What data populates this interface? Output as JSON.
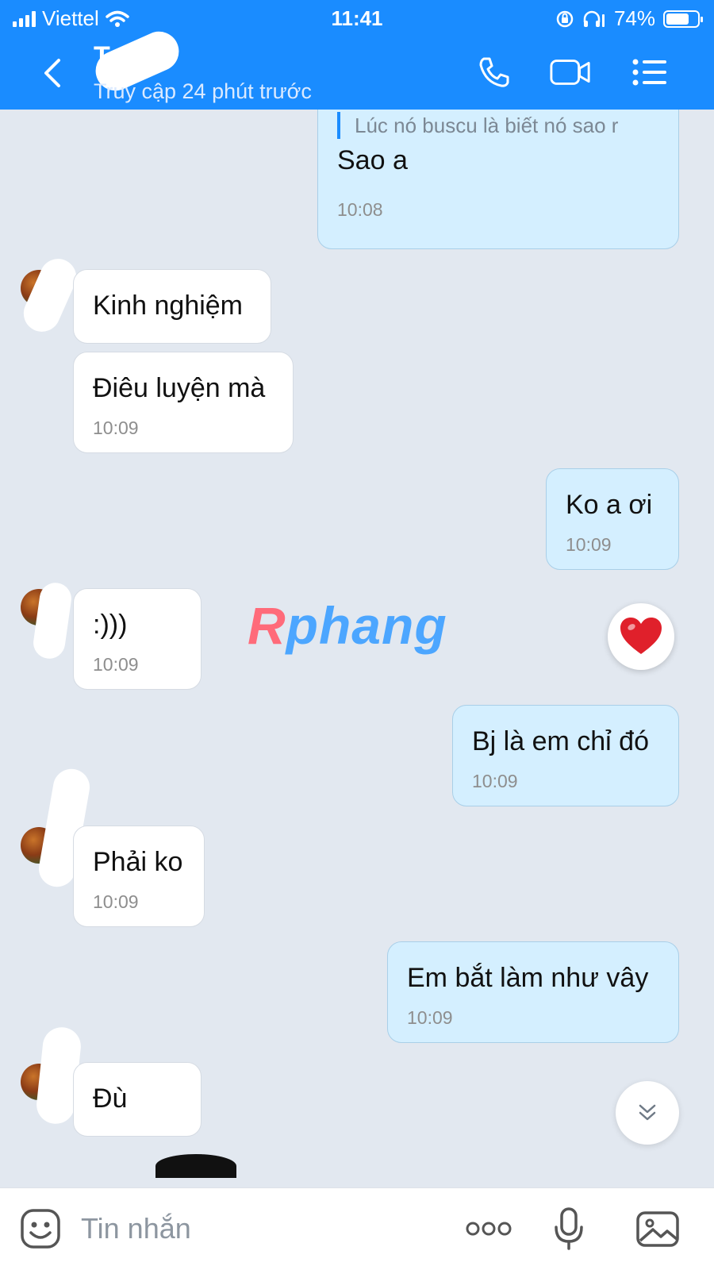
{
  "status_bar": {
    "carrier": "Viettel",
    "time": "11:41",
    "battery": "74%",
    "battery_level": 0.74
  },
  "header": {
    "contact_name": "Te",
    "last_seen": "Truy cập 24 phút trước"
  },
  "messages": [
    {
      "direction": "out",
      "quote": "Lúc nó buscu là biết nó sao r",
      "text": "Sao a",
      "time": "10:08"
    },
    {
      "direction": "in",
      "text": "Kinh nghiệm"
    },
    {
      "direction": "in",
      "text": "Điêu luyện mà",
      "time": "10:09"
    },
    {
      "direction": "out",
      "text": "Ko a ơi",
      "time": "10:09"
    },
    {
      "direction": "in",
      "text": ":)))",
      "time": "10:09"
    },
    {
      "direction": "out",
      "text": "Bj là em chỉ đó",
      "time": "10:09"
    },
    {
      "direction": "in",
      "text": "Phải ko",
      "time": "10:09"
    },
    {
      "direction": "out",
      "text": "Em bắt làm như vây",
      "time": "10:09"
    },
    {
      "direction": "in",
      "text": "Đù"
    }
  ],
  "watermark": {
    "first": "R",
    "rest": "phang"
  },
  "reaction": {
    "icon": "heart-icon",
    "color": "#e0202b"
  },
  "input": {
    "placeholder": "Tin nhắn"
  },
  "colors": {
    "header": "#1a8cff",
    "incoming_bubble": "#ffffff",
    "outgoing_bubble": "#d4efff",
    "background": "#e2e8f0"
  }
}
